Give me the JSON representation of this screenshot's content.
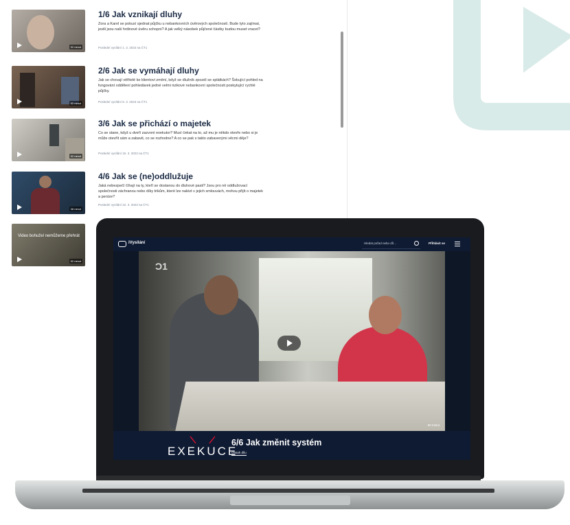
{
  "episodes": [
    {
      "title": "1/6 Jak vznikají dluhy",
      "description": "Zora a Karel se pokusí sjednat půjčku u nebankovních úvěrových společností. Bude tyto zajímat, jestli jsou naši hrdinové úvěru schopni? A jak velký násobek půjčené částky budou muset vracet?",
      "meta": "Poslední vysílání 1. 3. 2023 na ČT1",
      "duration": "52 minut",
      "thumb_color": "#8f8a83"
    },
    {
      "title": "2/6 Jak se vymáhají dluhy",
      "description": "Jak se chovají věřitelé ke klientovi změní, když se dlužník zpozdí se splátkách? Šokující pohled na fungování oddělení pohledávek jedné velmi rizikové nebankovní společnosti poskytující rychlé půjčky.",
      "meta": "Poslední vysílání 8. 3. 2023 na ČT1",
      "duration": "52 minut",
      "thumb_color": "#5e4a3c"
    },
    {
      "title": "3/6 Jak se přichází o majetek",
      "description": "Co se stane, když u dveří zazvoní exekutor? Musí čekat na to, až mu je někdo otevře nebo si je může otevřít sám a zabavit, co se rozhodne? A co se pak s takto zabavenými věcmi děje?",
      "meta": "Poslední vysílání 15. 3. 2023 na ČT1",
      "duration": "52 minut",
      "thumb_color": "#9c9a92"
    },
    {
      "title": "4/6 Jak se (ne)oddlužuje",
      "description": "Jaká nebezpečí číhají na ty, kteří se dostanou do dluhové pasti? Jsou pro ně oddlužovací společnosti záchranou nebo díky trikům, které lze nalézt v jejich smlouvách, mohou přijít o majetek a peníze?",
      "meta": "Poslední vysílání 22. 3. 2023 na ČT1",
      "duration": "38 minut",
      "thumb_color": "#3d5670"
    },
    {
      "title": "",
      "description": "",
      "meta": "",
      "duration": "52 minut",
      "thumb_color": "#6d6a5e",
      "overlay": "Video bohužel nemůžeme přehrát"
    }
  ],
  "player": {
    "brand": "iVysílání",
    "search_placeholder": "Hledat pořad nebo díl…",
    "login": "Přihlásit se",
    "channel": "1",
    "duration": "60 minut",
    "show_name": "EXEKUCE",
    "episode_title": "6/6 Jak změnit systém",
    "tab": "Obsah dílu"
  },
  "colors": {
    "accent": "#c8102e",
    "header_bg": "#0f1b33",
    "logo_tint": "#d9ebe8"
  }
}
